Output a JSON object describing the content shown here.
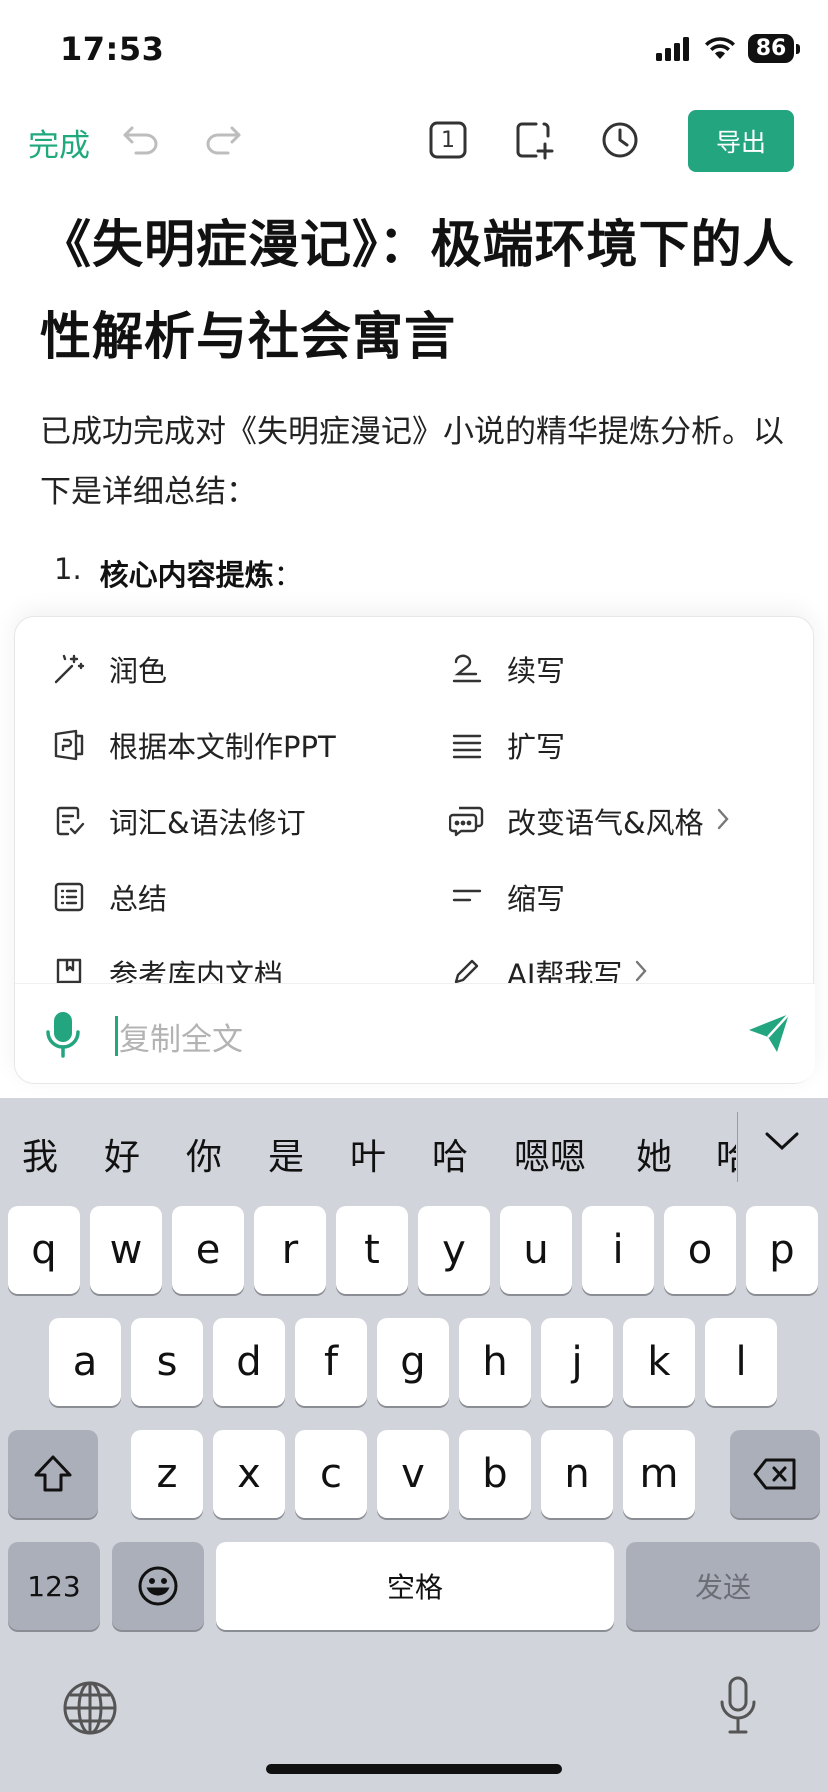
{
  "status": {
    "time": "17:53",
    "battery": "86"
  },
  "toolbar": {
    "done": "完成",
    "page_count": "1",
    "export": "导出"
  },
  "doc": {
    "title": "《失明症漫记》：极端环境下的人性解析与社会寓言",
    "intro": "已成功完成对《失明症漫记》小说的精华提炼分析。以下是详细总结：",
    "list_num": "1.",
    "list_title": "核心内容提炼",
    "list_colon": "："
  },
  "suggestions": {
    "polish": "润色",
    "continue": "续写",
    "ppt": "根据本文制作PPT",
    "expand": "扩写",
    "grammar": "词汇&语法修订",
    "tone": "改变语气&风格",
    "summary": "总结",
    "shorten": "缩写",
    "reference": "参考库内文档",
    "ai_write": "AI帮我写"
  },
  "input": {
    "placeholder": "复制全文"
  },
  "keyboard": {
    "candidates": [
      "我",
      "好",
      "你",
      "是",
      "叶",
      "哈",
      "嗯嗯",
      "她",
      "哈"
    ],
    "row1": [
      "q",
      "w",
      "e",
      "r",
      "t",
      "y",
      "u",
      "i",
      "o",
      "p"
    ],
    "row2": [
      "a",
      "s",
      "d",
      "f",
      "g",
      "h",
      "j",
      "k",
      "l"
    ],
    "row3": [
      "z",
      "x",
      "c",
      "v",
      "b",
      "n",
      "m"
    ],
    "numbers": "123",
    "space": "空格",
    "send": "发送"
  },
  "colors": {
    "accent": "#23a57f",
    "keyboard_bg": "#d1d4db"
  }
}
